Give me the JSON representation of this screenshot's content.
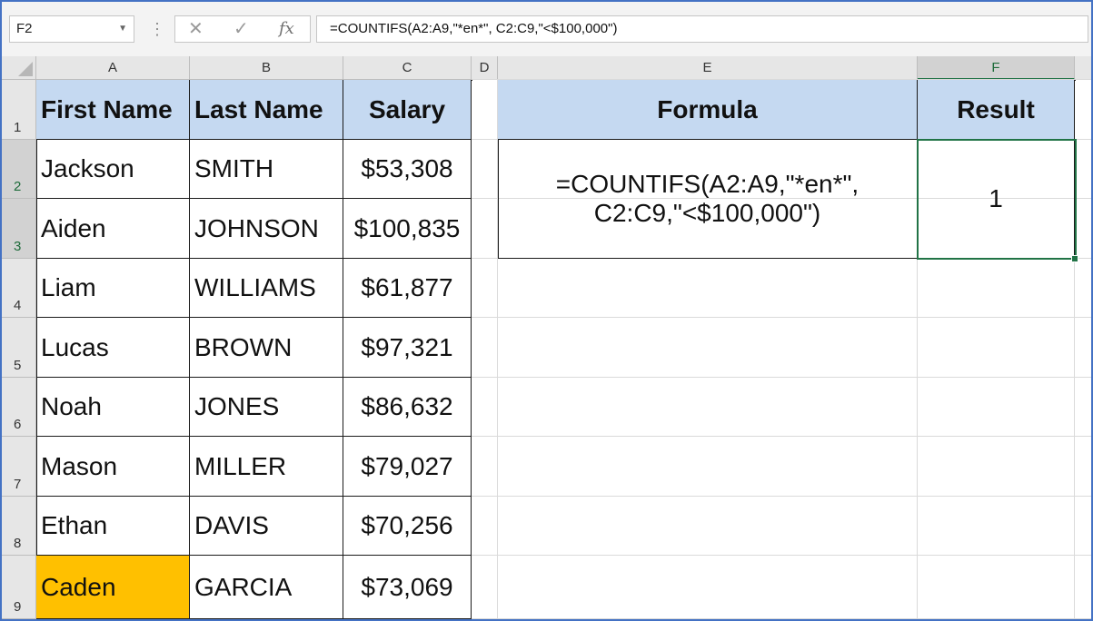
{
  "formula_bar": {
    "name_box": "F2",
    "cancel_icon": "✕",
    "enter_icon": "✓",
    "fx_label": "fx",
    "formula": "=COUNTIFS(A2:A9,\"*en*\", C2:C9,\"<$100,000\")"
  },
  "columns": [
    "A",
    "B",
    "C",
    "D",
    "E",
    "F"
  ],
  "rows": [
    "1",
    "2",
    "3",
    "4",
    "5",
    "6",
    "7",
    "8",
    "9"
  ],
  "table": {
    "headers": [
      "First Name",
      "Last Name",
      "Salary"
    ],
    "rows": [
      [
        "Jackson",
        "SMITH",
        "$53,308"
      ],
      [
        "Aiden",
        "JOHNSON",
        "$100,835"
      ],
      [
        "Liam",
        "WILLIAMS",
        "$61,877"
      ],
      [
        "Lucas",
        "BROWN",
        "$97,321"
      ],
      [
        "Noah",
        "JONES",
        "$86,632"
      ],
      [
        "Mason",
        "MILLER",
        "$79,027"
      ],
      [
        "Ethan",
        "DAVIS",
        "$70,256"
      ],
      [
        "Caden",
        "GARCIA",
        "$73,069"
      ]
    ],
    "highlight_color": "#ffc000"
  },
  "result_table": {
    "formula_header": "Formula",
    "result_header": "Result",
    "formula_text": "=COUNTIFS(A2:A9,\"*en*\", C2:C9,\"<$100,000\")",
    "result_value": "1"
  },
  "colors": {
    "header_fill": "#c5d9f1",
    "selection": "#217346",
    "frame_border": "#4472c4"
  }
}
